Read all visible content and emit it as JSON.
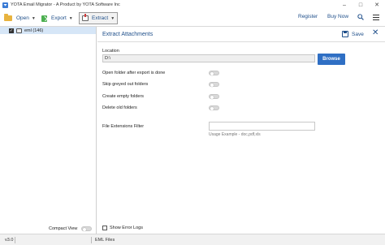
{
  "window": {
    "title": "YOTA Email Migrator - A Product by YOTA Software Inc",
    "minimize_icon": "minimize-icon",
    "maximize_icon": "maximize-icon",
    "close_icon": "close-icon"
  },
  "toolbar": {
    "open_label": "Open",
    "export_label": "Export",
    "extract_label": "Extract",
    "register_label": "Register",
    "buynow_label": "Buy Now"
  },
  "tree": {
    "root_label": "eml (146)",
    "checked": true
  },
  "left_footer": {
    "compact_view_label": "Compact View",
    "compact_view_on": false
  },
  "panel": {
    "title": "Extract Attachments",
    "save_label": "Save",
    "location_label": "Location",
    "location_value": "D:\\",
    "browse_label": "Browse",
    "options": [
      {
        "label": "Open folder after export is done",
        "on": false
      },
      {
        "label": "Skip greyed out folders",
        "on": false
      },
      {
        "label": "Create empty folders",
        "on": false
      },
      {
        "label": "Delete old folders",
        "on": false
      }
    ],
    "ext_filter_label": "File Extensions Filter",
    "ext_filter_value": "",
    "ext_filter_hint": "Usage Example - doc,pdf,xls",
    "show_error_logs_label": "Show Error Logs",
    "show_error_logs_checked": false
  },
  "status": {
    "version": "v3.0",
    "file_type": "EML Files"
  },
  "colors": {
    "accent": "#1f4f8a",
    "browse_button": "#2f6fc4",
    "tree_selection": "#d6e6f7"
  }
}
